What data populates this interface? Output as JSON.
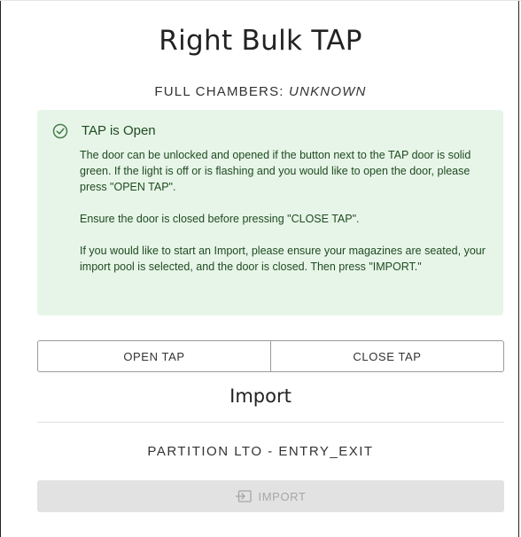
{
  "title": "Right Bulk TAP",
  "chambers": {
    "label": "FULL CHAMBERS: ",
    "value": "UNKNOWN"
  },
  "alert": {
    "icon": "check-circle-icon",
    "title": "TAP is Open",
    "paragraphs": [
      "The door can be unlocked and opened if the button next to the TAP door is solid green. If the light is off or is flashing and you would like to open the door, please press \"OPEN TAP\".",
      "Ensure the door is closed before pressing \"CLOSE TAP\".",
      "If you would like to start an Import, please ensure your magazines are seated, your import pool is selected, and the door is closed. Then press \"IMPORT.\""
    ],
    "colors": {
      "background": "#e7f5e8",
      "text": "#1f4b21",
      "icon": "#4a7c4d"
    }
  },
  "buttons": {
    "open_tap": "OPEN TAP",
    "close_tap": "CLOSE TAP"
  },
  "import_section": {
    "title": "Import",
    "partition": "PARTITION LTO - ENTRY_EXIT",
    "import_button": "IMPORT",
    "import_icon": "login-arrow-icon",
    "import_disabled": true
  }
}
